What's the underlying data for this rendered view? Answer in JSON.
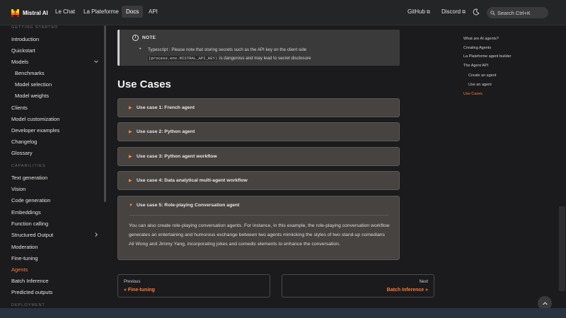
{
  "navbar": {
    "brand": "Mistral AI",
    "links": [
      "Le Chat",
      "La Plateforme",
      "Docs",
      "API"
    ],
    "active": "Docs",
    "github": "GitHub",
    "discord": "Discord",
    "search_placeholder": "Search Ctrl+K"
  },
  "sidebar": {
    "items": [
      {
        "label": "GETTING STARTED",
        "kind": "category"
      },
      {
        "label": "Introduction"
      },
      {
        "label": "Quickstart"
      },
      {
        "label": "Models",
        "chevron": "chevron-down-icon"
      },
      {
        "label": "Benchmarks",
        "kind": "sub"
      },
      {
        "label": "Model selection",
        "kind": "sub"
      },
      {
        "label": "Model weights",
        "kind": "sub"
      },
      {
        "label": "Clients"
      },
      {
        "label": "Model customization"
      },
      {
        "label": "Developer examples"
      },
      {
        "label": "Changelog"
      },
      {
        "label": "Glossary"
      },
      {
        "label": "CAPABILITIES",
        "kind": "category"
      },
      {
        "label": "Text generation"
      },
      {
        "label": "Vision"
      },
      {
        "label": "Code generation"
      },
      {
        "label": "Embeddings"
      },
      {
        "label": "Function calling"
      },
      {
        "label": "Structured Output",
        "chevron": "chevron-right-icon"
      },
      {
        "label": "Moderation"
      },
      {
        "label": "Fine-tuning"
      },
      {
        "label": "Agents",
        "active": true
      },
      {
        "label": "Batch Inference"
      },
      {
        "label": "Predicted outputs"
      },
      {
        "label": "DEPLOYMENT",
        "kind": "category"
      }
    ]
  },
  "note": {
    "heading": "NOTE",
    "text_prefix": "Typescript : Please note that storing secrets such as the API key on the client side",
    "code": "(process.env.MISTRAL_API_KEY)",
    "text_suffix": " is dangerous and may lead to secret disclosure"
  },
  "main": {
    "heading": "Use Cases",
    "accordions": [
      {
        "title": "Use case 1: French agent",
        "open": false
      },
      {
        "title": "Use case 2: Python agent",
        "open": false
      },
      {
        "title": "Use case 3: Python agent workflow",
        "open": false
      },
      {
        "title": "Use case 4: Data analytical multi-agent workflow",
        "open": false
      },
      {
        "title": "Use case 5: Role-playing Conversation agent",
        "open": true,
        "body": "You can also create role-playing conversation agents. For instance, in this example, the role-playing conversation workflow generates an entertaining and humorous exchange between two agents mimicking the styles of two stand-up comedians Ali Wong and Jimmy Yang, incorporating jokes and comedic elements to enhance the conversation."
      }
    ]
  },
  "pagination": {
    "previous_sub": "Previous",
    "previous_label": "« Fine-tuning",
    "next_sub": "Next",
    "next_label": "Batch Inference »"
  },
  "toc": {
    "items": [
      {
        "label": "What are AI agents?",
        "level": 1
      },
      {
        "label": "Creating Agents",
        "level": 1
      },
      {
        "label": "La Plateforme agent builder",
        "level": 1
      },
      {
        "label": "The Agent API",
        "level": 1
      },
      {
        "label": "Create an agent",
        "level": 2
      },
      {
        "label": "Use an agent",
        "level": 2
      },
      {
        "label": "Use Cases",
        "level": 1,
        "active": true
      }
    ]
  },
  "colors": {
    "accent": "#ff7a33",
    "background": "#1b1b1d",
    "navbar": "#242526",
    "accordion": "#474341"
  }
}
